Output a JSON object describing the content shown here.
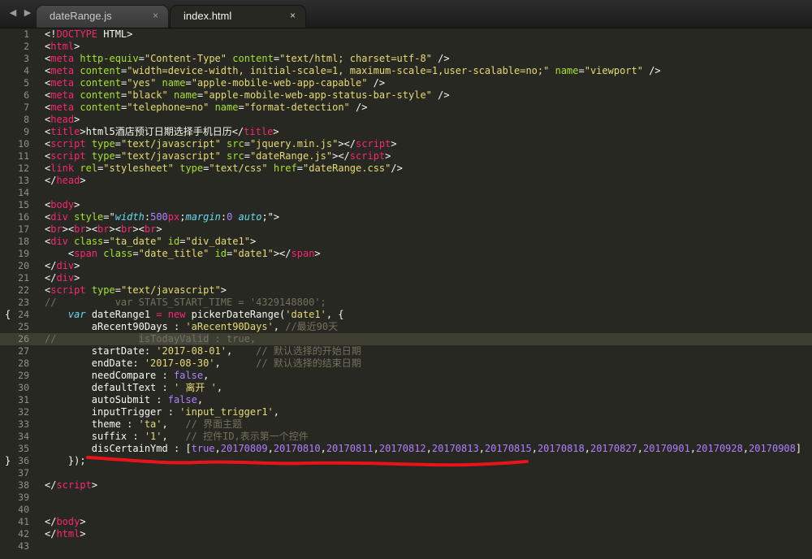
{
  "tabs": [
    {
      "label": "dateRange.js",
      "close": "×",
      "active": false
    },
    {
      "label": "index.html",
      "close": "×",
      "active": true
    }
  ],
  "nav": {
    "back": "◀",
    "forward": "▶"
  },
  "current_line": 26,
  "lines": [
    [
      [
        "w",
        "<!"
      ],
      [
        "t",
        "DOCTYPE"
      ],
      [
        "w",
        " HTML>"
      ]
    ],
    [
      [
        "w",
        "<"
      ],
      [
        "t",
        "html"
      ],
      [
        "w",
        ">"
      ]
    ],
    [
      [
        "w",
        "<"
      ],
      [
        "t",
        "meta"
      ],
      [
        "w",
        " "
      ],
      [
        "a",
        "http-equiv"
      ],
      [
        "w",
        "="
      ],
      [
        "s",
        "\"Content-Type\""
      ],
      [
        "w",
        " "
      ],
      [
        "a",
        "content"
      ],
      [
        "w",
        "="
      ],
      [
        "s",
        "\"text/html; charset=utf-8\""
      ],
      [
        "w",
        " />"
      ]
    ],
    [
      [
        "w",
        "<"
      ],
      [
        "t",
        "meta"
      ],
      [
        "w",
        " "
      ],
      [
        "a",
        "content"
      ],
      [
        "w",
        "="
      ],
      [
        "s",
        "\"width=device-width, initial-scale=1, maximum-scale=1,user-scalable=no;\""
      ],
      [
        "w",
        " "
      ],
      [
        "a",
        "name"
      ],
      [
        "w",
        "="
      ],
      [
        "s",
        "\"viewport\""
      ],
      [
        "w",
        " />"
      ]
    ],
    [
      [
        "w",
        "<"
      ],
      [
        "t",
        "meta"
      ],
      [
        "w",
        " "
      ],
      [
        "a",
        "content"
      ],
      [
        "w",
        "="
      ],
      [
        "s",
        "\"yes\""
      ],
      [
        "w",
        " "
      ],
      [
        "a",
        "name"
      ],
      [
        "w",
        "="
      ],
      [
        "s",
        "\"apple-mobile-web-app-capable\""
      ],
      [
        "w",
        " />"
      ]
    ],
    [
      [
        "w",
        "<"
      ],
      [
        "t",
        "meta"
      ],
      [
        "w",
        " "
      ],
      [
        "a",
        "content"
      ],
      [
        "w",
        "="
      ],
      [
        "s",
        "\"black\""
      ],
      [
        "w",
        " "
      ],
      [
        "a",
        "name"
      ],
      [
        "w",
        "="
      ],
      [
        "s",
        "\"apple-mobile-web-app-status-bar-style\""
      ],
      [
        "w",
        " />"
      ]
    ],
    [
      [
        "w",
        "<"
      ],
      [
        "t",
        "meta"
      ],
      [
        "w",
        " "
      ],
      [
        "a",
        "content"
      ],
      [
        "w",
        "="
      ],
      [
        "s",
        "\"telephone=no\""
      ],
      [
        "w",
        " "
      ],
      [
        "a",
        "name"
      ],
      [
        "w",
        "="
      ],
      [
        "s",
        "\"format-detection\""
      ],
      [
        "w",
        " />"
      ]
    ],
    [
      [
        "w",
        "<"
      ],
      [
        "t",
        "head"
      ],
      [
        "w",
        ">"
      ]
    ],
    [
      [
        "w",
        "<"
      ],
      [
        "t",
        "title"
      ],
      [
        "w",
        ">html5酒店预订日期选择手机日历</"
      ],
      [
        "t",
        "title"
      ],
      [
        "w",
        ">"
      ]
    ],
    [
      [
        "w",
        "<"
      ],
      [
        "t",
        "script"
      ],
      [
        "w",
        " "
      ],
      [
        "a",
        "type"
      ],
      [
        "w",
        "="
      ],
      [
        "s",
        "\"text/javascript\""
      ],
      [
        "w",
        " "
      ],
      [
        "a",
        "src"
      ],
      [
        "w",
        "="
      ],
      [
        "s",
        "\"jquery.min.js\""
      ],
      [
        "w",
        "></"
      ],
      [
        "t",
        "script"
      ],
      [
        "w",
        ">"
      ]
    ],
    [
      [
        "w",
        "<"
      ],
      [
        "t",
        "script"
      ],
      [
        "w",
        " "
      ],
      [
        "a",
        "type"
      ],
      [
        "w",
        "="
      ],
      [
        "s",
        "\"text/javascript\""
      ],
      [
        "w",
        " "
      ],
      [
        "a",
        "src"
      ],
      [
        "w",
        "="
      ],
      [
        "s",
        "\"dateRange.js\""
      ],
      [
        "w",
        "></"
      ],
      [
        "t",
        "script"
      ],
      [
        "w",
        ">"
      ]
    ],
    [
      [
        "w",
        "<"
      ],
      [
        "t",
        "link"
      ],
      [
        "w",
        " "
      ],
      [
        "a",
        "rel"
      ],
      [
        "w",
        "="
      ],
      [
        "s",
        "\"stylesheet\""
      ],
      [
        "w",
        " "
      ],
      [
        "a",
        "type"
      ],
      [
        "w",
        "="
      ],
      [
        "s",
        "\"text/css\""
      ],
      [
        "w",
        " "
      ],
      [
        "a",
        "href"
      ],
      [
        "w",
        "="
      ],
      [
        "s",
        "\"dateRange.css\""
      ],
      [
        "w",
        "/>"
      ]
    ],
    [
      [
        "w",
        "</"
      ],
      [
        "t",
        "head"
      ],
      [
        "w",
        ">"
      ]
    ],
    [],
    [
      [
        "w",
        "<"
      ],
      [
        "t",
        "body"
      ],
      [
        "w",
        ">"
      ]
    ],
    [
      [
        "w",
        "<"
      ],
      [
        "t",
        "div"
      ],
      [
        "w",
        " "
      ],
      [
        "a",
        "style"
      ],
      [
        "w",
        "=\""
      ],
      [
        "k",
        "width"
      ],
      [
        "w",
        ":"
      ],
      [
        "n",
        "500"
      ],
      [
        "t",
        "px"
      ],
      [
        "w",
        ";"
      ],
      [
        "k",
        "margin"
      ],
      [
        "w",
        ":"
      ],
      [
        "n",
        "0"
      ],
      [
        "w",
        " "
      ],
      [
        "k",
        "auto"
      ],
      [
        "w",
        ";\">"
      ]
    ],
    [
      [
        "w",
        "<"
      ],
      [
        "t",
        "br"
      ],
      [
        "w",
        "><"
      ],
      [
        "t",
        "br"
      ],
      [
        "w",
        "><"
      ],
      [
        "t",
        "br"
      ],
      [
        "w",
        "><"
      ],
      [
        "t",
        "br"
      ],
      [
        "w",
        "><"
      ],
      [
        "t",
        "br"
      ],
      [
        "w",
        ">"
      ]
    ],
    [
      [
        "w",
        "<"
      ],
      [
        "t",
        "div"
      ],
      [
        "w",
        " "
      ],
      [
        "a",
        "class"
      ],
      [
        "w",
        "="
      ],
      [
        "s",
        "\"ta_date\""
      ],
      [
        "w",
        " "
      ],
      [
        "a",
        "id"
      ],
      [
        "w",
        "="
      ],
      [
        "s",
        "\"div_date1\""
      ],
      [
        "w",
        ">"
      ]
    ],
    [
      [
        "w",
        "    <"
      ],
      [
        "t",
        "span"
      ],
      [
        "w",
        " "
      ],
      [
        "a",
        "class"
      ],
      [
        "w",
        "="
      ],
      [
        "s",
        "\"date_title\""
      ],
      [
        "w",
        " "
      ],
      [
        "a",
        "id"
      ],
      [
        "w",
        "="
      ],
      [
        "s",
        "\"date1\""
      ],
      [
        "w",
        "></"
      ],
      [
        "t",
        "span"
      ],
      [
        "w",
        ">"
      ]
    ],
    [
      [
        "w",
        "</"
      ],
      [
        "t",
        "div"
      ],
      [
        "w",
        ">"
      ]
    ],
    [
      [
        "w",
        "</"
      ],
      [
        "t",
        "div"
      ],
      [
        "w",
        ">"
      ]
    ],
    [
      [
        "w",
        "<"
      ],
      [
        "t",
        "script"
      ],
      [
        "w",
        " "
      ],
      [
        "a",
        "type"
      ],
      [
        "w",
        "="
      ],
      [
        "s",
        "\"text/javascript\""
      ],
      [
        "w",
        ">"
      ]
    ],
    [
      [
        "c",
        "//          var STATS_START_TIME = '4329148800';"
      ]
    ],
    [
      [
        "w",
        "    "
      ],
      [
        "k",
        "var"
      ],
      [
        "w",
        " dateRange1 "
      ],
      [
        "t",
        "="
      ],
      [
        "w",
        " "
      ],
      [
        "t",
        "new"
      ],
      [
        "w",
        " pickerDateRange("
      ],
      [
        "s",
        "'date1'"
      ],
      [
        "w",
        ", {"
      ]
    ],
    [
      [
        "w",
        "        aRecent90Days : "
      ],
      [
        "s",
        "'aRecent90Days'"
      ],
      [
        "w",
        ", "
      ],
      [
        "c",
        "//最近90天"
      ]
    ],
    [
      [
        "c",
        "//"
      ],
      [
        "w",
        "              "
      ],
      [
        "c sel",
        "isTodayValid"
      ],
      [
        "c",
        " : true,"
      ]
    ],
    [
      [
        "w",
        "        startDate: "
      ],
      [
        "s",
        "'2017-08-01'"
      ],
      [
        "w",
        ",    "
      ],
      [
        "c",
        "// 默认选择的开始日期"
      ]
    ],
    [
      [
        "w",
        "        endDate: "
      ],
      [
        "s",
        "'2017-08-30'"
      ],
      [
        "w",
        ",      "
      ],
      [
        "c",
        "// 默认选择的结束日期"
      ]
    ],
    [
      [
        "w",
        "        needCompare : "
      ],
      [
        "d",
        "false"
      ],
      [
        "w",
        ","
      ]
    ],
    [
      [
        "w",
        "        defaultText : "
      ],
      [
        "s",
        "' 离开 '"
      ],
      [
        "w",
        ","
      ]
    ],
    [
      [
        "w",
        "        autoSubmit : "
      ],
      [
        "d",
        "false"
      ],
      [
        "w",
        ","
      ]
    ],
    [
      [
        "w",
        "        inputTrigger : "
      ],
      [
        "s",
        "'input_trigger1'"
      ],
      [
        "w",
        ","
      ]
    ],
    [
      [
        "w",
        "        theme : "
      ],
      [
        "s",
        "'ta'"
      ],
      [
        "w",
        ",   "
      ],
      [
        "c",
        "// 界面主题"
      ]
    ],
    [
      [
        "w",
        "        suffix : "
      ],
      [
        "s",
        "'1'"
      ],
      [
        "w",
        ",   "
      ],
      [
        "c",
        "// 控件ID,表示第一个控件"
      ]
    ],
    [
      [
        "w",
        "        disCertainYmd : ["
      ],
      [
        "d",
        "true"
      ],
      [
        "w",
        ","
      ],
      [
        "n",
        "20170809"
      ],
      [
        "w",
        ","
      ],
      [
        "n",
        "20170810"
      ],
      [
        "w",
        ","
      ],
      [
        "n",
        "20170811"
      ],
      [
        "w",
        ","
      ],
      [
        "n",
        "20170812"
      ],
      [
        "w",
        ","
      ],
      [
        "n",
        "20170813"
      ],
      [
        "w",
        ","
      ],
      [
        "n",
        "20170815"
      ],
      [
        "w",
        ","
      ],
      [
        "n",
        "20170818"
      ],
      [
        "w",
        ","
      ],
      [
        "n",
        "20170827"
      ],
      [
        "w",
        ","
      ],
      [
        "n",
        "20170901"
      ],
      [
        "w",
        ","
      ],
      [
        "n",
        "20170928"
      ],
      [
        "w",
        ","
      ],
      [
        "n",
        "20170908"
      ],
      [
        "w",
        "]"
      ]
    ],
    [
      [
        "w",
        "    });"
      ]
    ],
    [],
    [
      [
        "w",
        "</"
      ],
      [
        "t",
        "script"
      ],
      [
        "w",
        ">"
      ]
    ],
    [],
    [],
    [
      [
        "w",
        "</"
      ],
      [
        "t",
        "body"
      ],
      [
        "w",
        ">"
      ]
    ],
    [
      [
        "w",
        "</"
      ],
      [
        "t",
        "html"
      ],
      [
        "w",
        ">"
      ]
    ],
    []
  ],
  "annotation_color": "#e8141c"
}
